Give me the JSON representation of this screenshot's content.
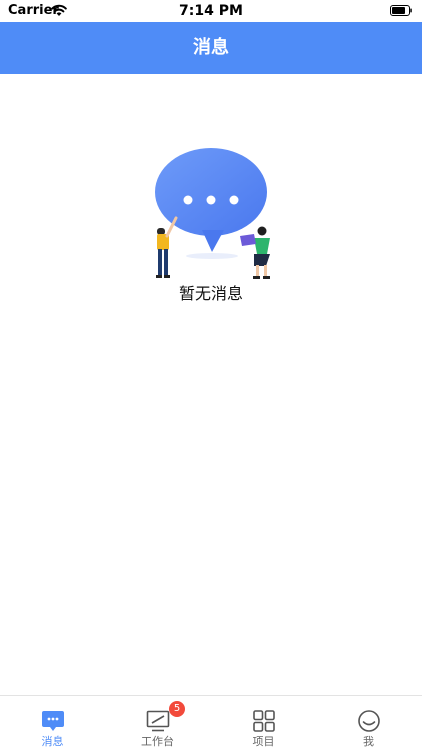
{
  "status_bar": {
    "carrier": "Carrier",
    "time": "7:14 PM"
  },
  "header": {
    "title": "消息"
  },
  "empty_state": {
    "text": "暂无消息",
    "illustration": "chat-bubble-people-illustration"
  },
  "tab_bar": {
    "tabs": [
      {
        "label": "消息",
        "icon": "message-icon",
        "active": true
      },
      {
        "label": "工作台",
        "icon": "workbench-icon",
        "active": false,
        "badge": "5"
      },
      {
        "label": "项目",
        "icon": "grid-icon",
        "active": false
      },
      {
        "label": "我",
        "icon": "profile-icon",
        "active": false
      }
    ]
  },
  "colors": {
    "accent": "#4f8cf7",
    "badge": "#f24a3b",
    "inactive": "#666666"
  }
}
